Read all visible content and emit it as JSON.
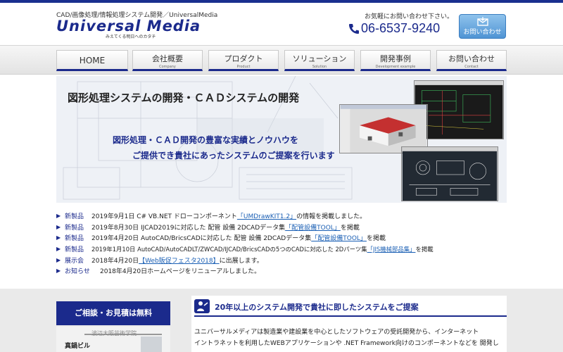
{
  "header": {
    "tagline": "CAD/画像処理/情報処理システム開発／UniversalMedia",
    "logo_text": "Universal Media",
    "logo_sub": "みえてくる明日へのカタチ",
    "contact_note": "お気軽にお問い合わせ下さい。",
    "phone": "06-6537-9240",
    "inquiry_label": "お問い合わせ"
  },
  "nav": {
    "items": [
      {
        "label": "HOME",
        "sub": ""
      },
      {
        "label": "会社概要",
        "sub": "Company"
      },
      {
        "label": "プロダクト",
        "sub": "Product"
      },
      {
        "label": "ソリューション",
        "sub": "Solution"
      },
      {
        "label": "開発事例",
        "sub": "Development example"
      },
      {
        "label": "お問い合わせ",
        "sub": "Contact"
      }
    ]
  },
  "hero": {
    "title": "図形処理システムの開発・ＣＡＤシステムの開発",
    "line1": "図形処理・ＣＡＤ開発の豊富な実績とノウハウを",
    "line2": "ご提供でき貴社にあったシステムのご提案を行います"
  },
  "news": [
    {
      "cat": "新製品",
      "text": "2019年9月1日 C# VB.NET ドローコンポーネント",
      "link": "「UMDrawKIT1.2」",
      "after": "の情報を掲載しました。"
    },
    {
      "cat": "新製品",
      "text": "2019年8月30日 IJCAD2019に対応した 配管 設備 2DCADデータ集",
      "link": "「配管設備TOOL」",
      "after": "を掲載"
    },
    {
      "cat": "新製品",
      "text": "2019年4月20日 AutoCAD/BricsCADに対応した 配管 設備 2DCADデータ集",
      "link": "「配管設備TOOL」",
      "after": "を掲載"
    },
    {
      "cat": "新製品",
      "text": "2019年1月10日 AutoCAD/AutoCADLT/ZWCAD/IJCAD/BricsCADの5つのCADに対応した 2Dパーツ集",
      "link": "「JIS機械部品集」",
      "after": "を掲載"
    },
    {
      "cat": "展示会",
      "text": "2018年4月20日",
      "link": "【Web販促フェスタ2018】",
      "after": "に出展します。"
    },
    {
      "cat": "お知らせ",
      "text": "2018年4月20日ホームページをリニューアルしました。",
      "link": "",
      "after": ""
    }
  ],
  "sidebar": {
    "heading": "ご相談・お見積は無料",
    "image_building": "真鍋ビル",
    "image_sign": "波辺大阪芸術学院"
  },
  "main": {
    "heading": "20年以上のシステム開発で貴社に即したシステムをご提案",
    "para1": "ユニバーサルメディアは製造業や建設業を中心としたソフトウェアの受託開発から、インターネット",
    "para2": "イントラネットを利用したWEBアプリケーションや .NET Framework向けのコンポーネントなどを 開発し"
  },
  "colors": {
    "brand": "#1b2a8c",
    "link": "#1a5fb4",
    "button": "#4f94d4"
  }
}
